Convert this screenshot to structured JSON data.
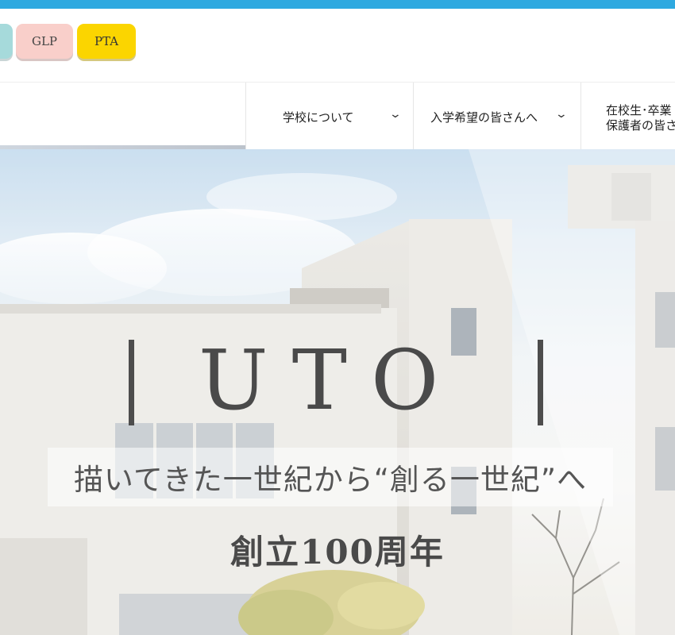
{
  "header": {
    "pills": [
      {
        "label": ""
      },
      {
        "label": "GLP"
      },
      {
        "label": "PTA"
      }
    ]
  },
  "nav": {
    "items": [
      {
        "label": "学校について"
      },
      {
        "label": "入学希望の皆さんへ"
      },
      {
        "label_line1": "在校生･卒業",
        "label_line2": "保護者の皆さ"
      }
    ]
  },
  "hero": {
    "title": "UTO",
    "tagline": "描いてきた一世紀から“創る一世紀”へ",
    "anniversary": "創立100周年"
  },
  "colors": {
    "topbar": "#2ea9e0",
    "accent_yellow": "#f8d400",
    "pill_teal": "#a6dadb",
    "pill_pink": "#f9cfca"
  }
}
